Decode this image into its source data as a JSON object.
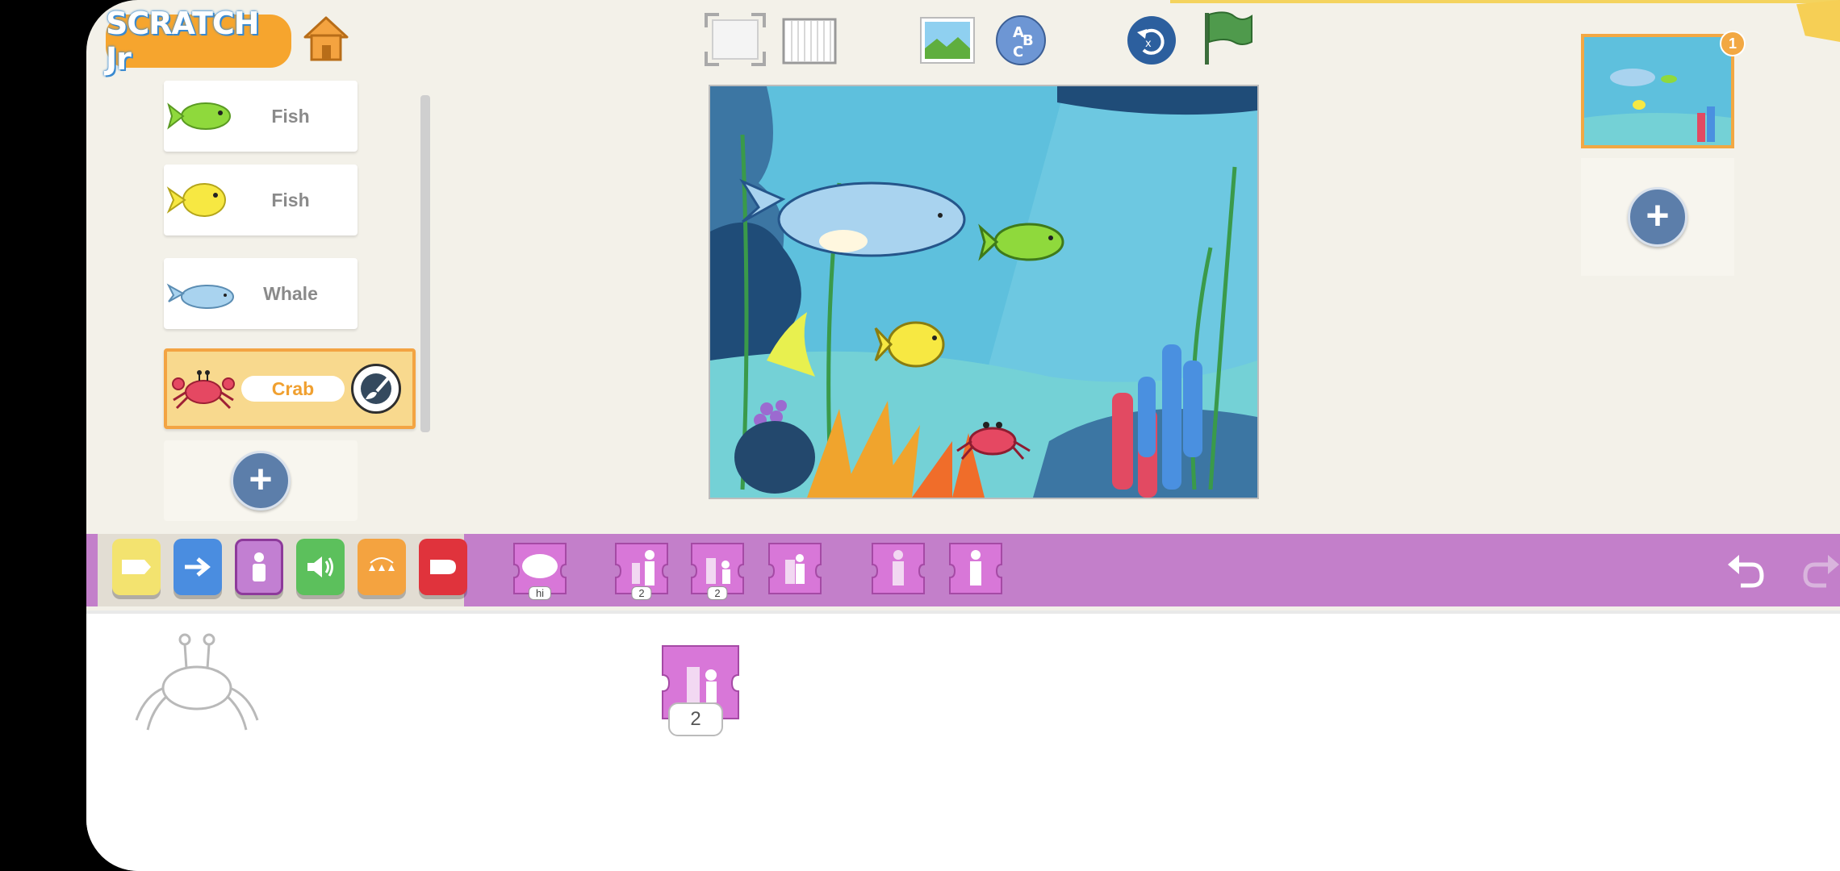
{
  "app": {
    "logo_text": "SCRATCH Jr",
    "accent_color": "#f6a52e",
    "toolbar": {
      "home": "home-icon",
      "fullscreen": "fullscreen-icon",
      "grid": "grid-icon",
      "background": "background-image-icon",
      "text": "text-abc-icon",
      "reset": "reset-characters-icon",
      "green_flag": "green-flag-icon"
    }
  },
  "sprites": [
    {
      "name": "Fish",
      "color": "#8fd93c"
    },
    {
      "name": "Fish",
      "color": "#f7e842"
    },
    {
      "name": "Whale",
      "color": "#a9d3ef"
    },
    {
      "name": "Crab",
      "color": "#e54862",
      "selected": true
    }
  ],
  "pages": {
    "current_page_number": "1"
  },
  "palette": {
    "color": "#c37fca",
    "categories": [
      {
        "name": "triggering",
        "color": "#f3e36f"
      },
      {
        "name": "motion",
        "color": "#4a8de0"
      },
      {
        "name": "looks",
        "color": "#c27fd2"
      },
      {
        "name": "sound",
        "color": "#5cc05c"
      },
      {
        "name": "control",
        "color": "#f4a340"
      },
      {
        "name": "end",
        "color": "#e0333c"
      }
    ],
    "blocks": [
      {
        "name": "say",
        "label": "hi"
      },
      {
        "name": "grow",
        "label": "2"
      },
      {
        "name": "shrink",
        "label": "2"
      },
      {
        "name": "reset-size",
        "label": ""
      },
      {
        "name": "hide",
        "label": ""
      },
      {
        "name": "show",
        "label": ""
      }
    ]
  },
  "script": {
    "block_name": "shrink",
    "block_value": "2"
  }
}
